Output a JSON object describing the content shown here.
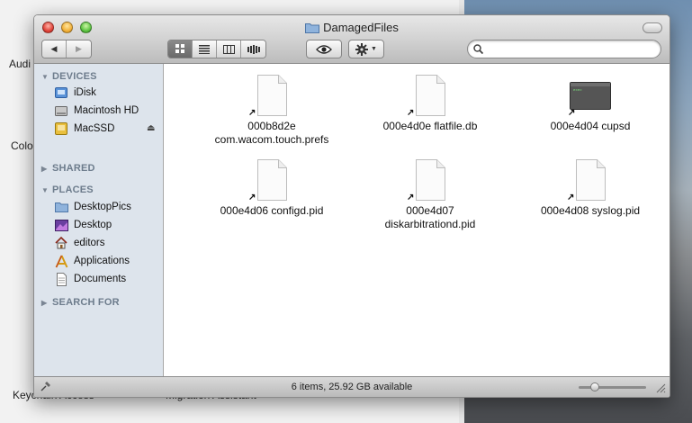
{
  "background": {
    "labels": [
      {
        "key": "audio",
        "text": "Audi"
      },
      {
        "key": "color",
        "text": "Colo"
      },
      {
        "key": "keychain",
        "text": "Keychain Access"
      },
      {
        "key": "migration",
        "text": "Migration Assistant"
      }
    ]
  },
  "window": {
    "title": "DamagedFiles",
    "status": "6 items, 25.92 GB available"
  },
  "toolbar": {
    "back_label": "◀",
    "forward_label": "▶",
    "search_placeholder": "",
    "search_value": "",
    "active_view": "icon"
  },
  "sidebar": {
    "sections": {
      "devices": "DEVICES",
      "shared": "SHARED",
      "places": "PLACES",
      "search_for": "SEARCH FOR"
    },
    "devices": [
      {
        "label": "iDisk",
        "icon": "idisk-icon"
      },
      {
        "label": "Macintosh HD",
        "icon": "hard-drive-icon"
      },
      {
        "label": "MacSSD",
        "icon": "external-drive-icon"
      }
    ],
    "places": [
      {
        "label": "DesktopPics",
        "icon": "folder-icon"
      },
      {
        "label": "Desktop",
        "icon": "desktop-icon"
      },
      {
        "label": "editors",
        "icon": "home-icon"
      },
      {
        "label": "Applications",
        "icon": "applications-icon"
      },
      {
        "label": "Documents",
        "icon": "documents-icon"
      }
    ]
  },
  "files": [
    {
      "name": "000b8d2e com.wacom.touch.prefs",
      "kind": "document"
    },
    {
      "name": "000e4d0e flatfile.db",
      "kind": "document"
    },
    {
      "name": "000e4d04 cupsd",
      "kind": "executable"
    },
    {
      "name": "000e4d06 configd.pid",
      "kind": "document"
    },
    {
      "name": "000e4d07 diskarbitrationd.pid",
      "kind": "document"
    },
    {
      "name": "000e4d08 syslog.pid",
      "kind": "document"
    }
  ],
  "icon_size_slider": 0.2,
  "colors": {
    "sidebar_bg": "#dde4ec",
    "section_header": "#6d7c8c",
    "window_chrome": "#d2d2d2"
  }
}
